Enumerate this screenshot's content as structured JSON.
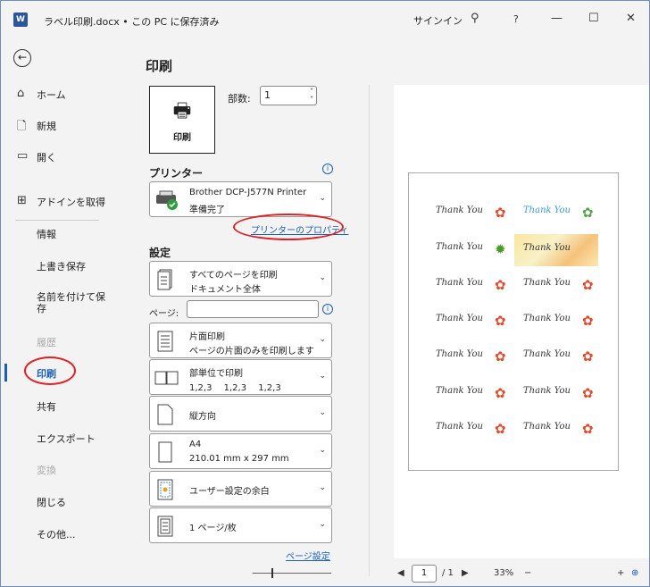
{
  "window": {
    "title": "ラベル印刷.docx • この PC に保存済み",
    "signin": "サインイン",
    "help": "?"
  },
  "sidebar": {
    "items": [
      {
        "label": "ホーム",
        "icon": "home-icon"
      },
      {
        "label": "新規",
        "icon": "new-document-icon"
      },
      {
        "label": "開く",
        "icon": "folder-open-icon"
      },
      {
        "label": "アドインを取得",
        "icon": "addins-icon"
      },
      {
        "label": "情報"
      },
      {
        "label": "上書き保存"
      },
      {
        "label": "名前を付けて保存"
      },
      {
        "label": "履歴",
        "disabled": true
      },
      {
        "label": "印刷",
        "active": true
      },
      {
        "label": "共有"
      },
      {
        "label": "エクスポート"
      },
      {
        "label": "変換",
        "disabled": true
      },
      {
        "label": "閉じる"
      },
      {
        "label": "その他..."
      }
    ]
  },
  "print": {
    "title": "印刷",
    "button_label": "印刷",
    "copies_label": "部数:",
    "copies_value": "1",
    "printer_header": "プリンター",
    "printer_name": "Brother DCP-J577N Printer",
    "printer_status": "準備完了",
    "printer_properties_link": "プリンターのプロパティ",
    "settings_header": "設定",
    "pages_label": "ページ:",
    "pages_value": "",
    "page_setup_link": "ページ設定",
    "settings": [
      {
        "line1": "すべてのページを印刷",
        "line2": "ドキュメント全体"
      },
      {
        "line1": "片面印刷",
        "line2": "ページの片面のみを印刷します"
      },
      {
        "line1": "部単位で印刷",
        "line2": "1,2,3　 1,2,3 　1,2,3"
      },
      {
        "line1": "縦方向",
        "line2": ""
      },
      {
        "line1": "A4",
        "line2": "210.01 mm x 297 mm"
      },
      {
        "line1": "ユーザー設定の余白",
        "line2": ""
      },
      {
        "line1": "1 ページ/枚",
        "line2": ""
      }
    ]
  },
  "preview": {
    "labels": [
      {
        "text": "Thank You",
        "flower": "✿",
        "color": "#e04a2a"
      },
      {
        "text": "Thank You",
        "flower": "✿",
        "color": "#5aa04a",
        "text_color": "#3a9ad0"
      },
      {
        "text": "Thank You",
        "flower": "✹",
        "color": "#4a9a2a"
      },
      {
        "text": "Thank You",
        "flower": "",
        "color": "#f0c040"
      },
      {
        "text": "Thank You",
        "flower": "✿",
        "color": "#e04a2a"
      },
      {
        "text": "Thank You",
        "flower": "✿",
        "color": "#e04a2a"
      },
      {
        "text": "Thank You",
        "flower": "✿",
        "color": "#e04a2a"
      },
      {
        "text": "Thank You",
        "flower": "✿",
        "color": "#e04a2a"
      },
      {
        "text": "Thank You",
        "flower": "✿",
        "color": "#e04a2a"
      },
      {
        "text": "Thank You",
        "flower": "✿",
        "color": "#e04a2a"
      },
      {
        "text": "Thank You",
        "flower": "✿",
        "color": "#e04a2a"
      },
      {
        "text": "Thank You",
        "flower": "✿",
        "color": "#e04a2a"
      },
      {
        "text": "Thank You",
        "flower": "✿",
        "color": "#e04a2a"
      },
      {
        "text": "Thank You",
        "flower": "✿",
        "color": "#e04a2a"
      }
    ]
  },
  "status": {
    "current_page": "1",
    "total_pages": "/ 1",
    "zoom": "33%",
    "zoom_minus": "−",
    "zoom_plus": "+"
  },
  "colors": {
    "accent": "#1a5fb4",
    "highlight_circle": "#e02020"
  }
}
